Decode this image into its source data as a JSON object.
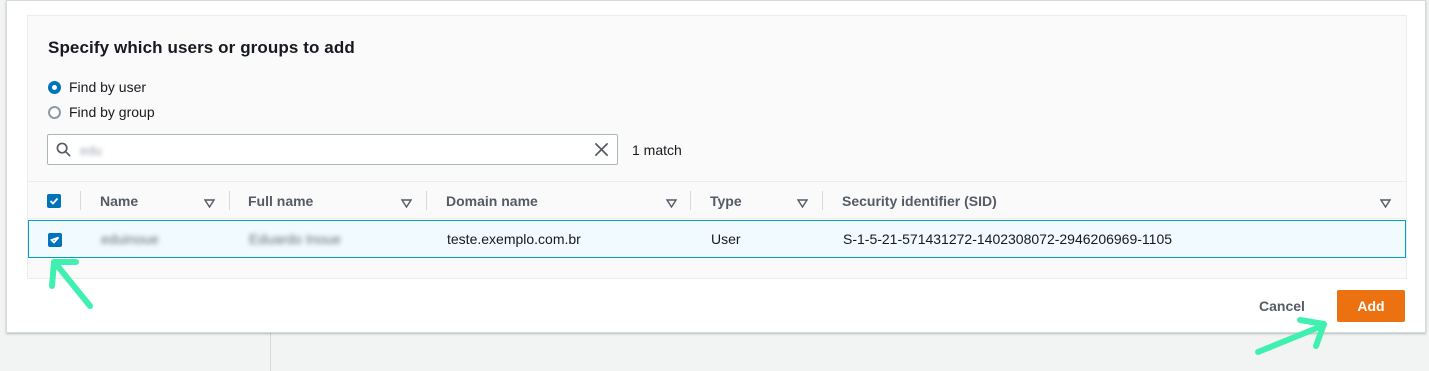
{
  "dialog": {
    "title": "Specify which users or groups to add",
    "find_options": [
      {
        "label": "Find by user",
        "selected": true
      },
      {
        "label": "Find by group",
        "selected": false
      }
    ],
    "search": {
      "value": "edu",
      "placeholder": ""
    },
    "match_count": "1 match"
  },
  "table": {
    "columns": [
      "Name",
      "Full name",
      "Domain name",
      "Type",
      "Security identifier (SID)"
    ],
    "select_all_checked": true,
    "rows": [
      {
        "checked": true,
        "name": "eduinoue",
        "full_name": "Eduardo Inoue",
        "domain_name": "teste.exemplo.com.br",
        "type": "User",
        "sid": "S-1-5-21-571431272-1402308072-2946206969-1105"
      }
    ]
  },
  "footer": {
    "cancel_label": "Cancel",
    "add_label": "Add"
  },
  "colors": {
    "primary_button": "#ec7211",
    "checkbox": "#0073bb",
    "selected_row_bg": "#f1faff",
    "annotation_arrow": "#3ff0b0"
  },
  "icons": [
    "search-icon",
    "close-icon",
    "sort-caret-icon",
    "checkmark-icon",
    "annotation-arrow-icon"
  ]
}
